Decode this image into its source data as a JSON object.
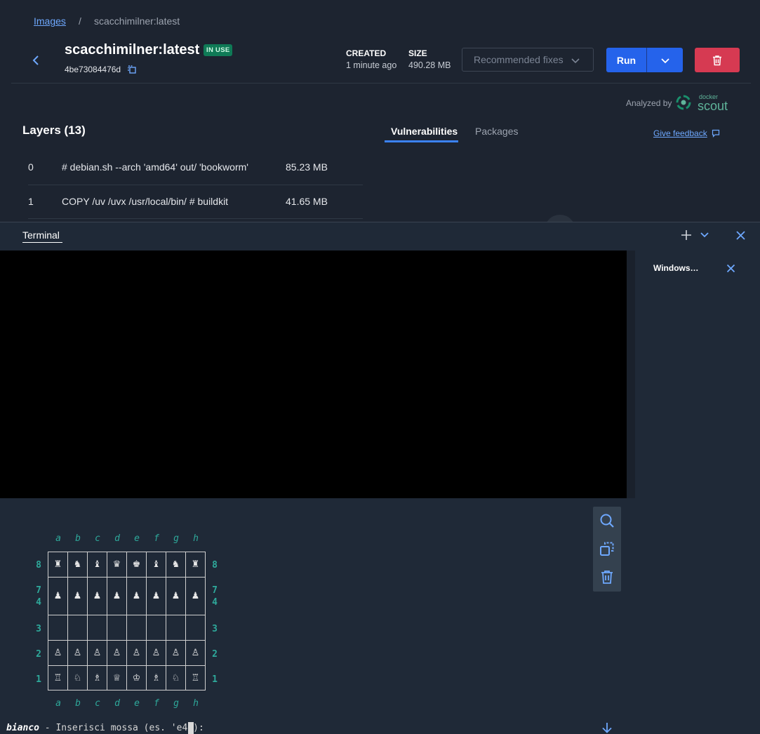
{
  "breadcrumb": {
    "parent": "Images",
    "separator": "/",
    "current": "scacchimilner:latest"
  },
  "image": {
    "name": "scacchimilner:latest",
    "badge": "IN USE",
    "digest": "4be73084476d"
  },
  "meta": {
    "created_label": "CREATED",
    "created_value": "1 minute ago",
    "size_label": "SIZE",
    "size_value": "490.28 MB"
  },
  "actions": {
    "recommended_fixes": "Recommended fixes",
    "run": "Run"
  },
  "analysis": {
    "analyzed_by": "Analyzed by",
    "brand_small": "docker",
    "brand": "scout"
  },
  "layers": {
    "heading": "Layers (13)",
    "rows": [
      {
        "index": "0",
        "command": "# debian.sh --arch 'amd64' out/ 'bookworm'",
        "size": "85.23 MB"
      },
      {
        "index": "1",
        "command": "COPY /uv /uvx /usr/local/bin/ # buildkit",
        "size": "41.65 MB"
      }
    ]
  },
  "tabs": {
    "vulnerabilities": "Vulnerabilities",
    "packages": "Packages",
    "give_feedback": "Give feedback"
  },
  "terminal": {
    "tab": "Terminal",
    "side_title": "Windows…",
    "files": [
      "a",
      "b",
      "c",
      "d",
      "e",
      "f",
      "g",
      "h"
    ],
    "ranks": [
      {
        "left": "8",
        "right": "8",
        "pieces": [
          "♜",
          "♞",
          "♝",
          "♛",
          "♚",
          "♝",
          "♞",
          "♜"
        ]
      },
      {
        "left": "7\n4",
        "right": "7\n4",
        "pieces": [
          "♟",
          "♟",
          "♟",
          "♟",
          "♟",
          "♟",
          "♟",
          "♟"
        ]
      },
      {
        "left": "3",
        "right": "3",
        "pieces": [
          "",
          "",
          "",
          "",
          "",
          "",
          "",
          ""
        ]
      },
      {
        "left": "2",
        "right": "2",
        "pieces": [
          "♙",
          "♙",
          "♙",
          "♙",
          "♙",
          "♙",
          "♙",
          "♙"
        ]
      },
      {
        "left": "1",
        "right": "1",
        "pieces": [
          "♖",
          "♘",
          "♗",
          "♕",
          "♔",
          "♗",
          "♘",
          "♖"
        ]
      }
    ],
    "prompt_player": "bianco",
    "prompt_text": " - Inserisci mossa (es. 'e4'): "
  },
  "colors": {
    "accent": "#2563eb",
    "danger": "#d63a52",
    "badge": "#0f7a56",
    "terminal_label": "#2ea99b",
    "link": "#6ea8fe"
  },
  "icons": [
    "chevron-left-icon",
    "copy-icon",
    "chevron-down-icon",
    "trash-icon",
    "docker-scout-logo",
    "feedback-icon",
    "plus-icon",
    "close-icon",
    "search-icon",
    "trash-icon",
    "arrow-down-icon"
  ]
}
